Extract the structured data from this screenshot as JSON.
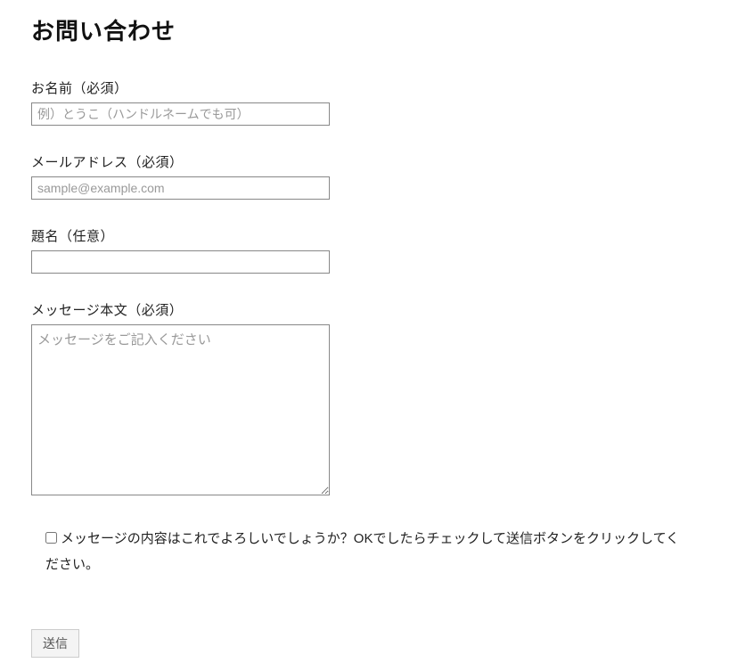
{
  "page": {
    "title": "お問い合わせ"
  },
  "form": {
    "name": {
      "label": "お名前（必須）",
      "placeholder": "例）とうこ（ハンドルネームでも可）",
      "value": ""
    },
    "email": {
      "label": "メールアドレス（必須）",
      "placeholder": "sample@example.com",
      "value": ""
    },
    "subject": {
      "label": "題名（任意）",
      "placeholder": "",
      "value": ""
    },
    "message": {
      "label": "メッセージ本文（必須）",
      "placeholder": "メッセージをご記入ください",
      "value": ""
    },
    "confirm": {
      "label": "メッセージの内容はこれでよろしいでしょうか？OKでしたらチェックして送信ボタンをクリックしてください。",
      "checked": false
    },
    "submit": {
      "label": "送信"
    }
  }
}
